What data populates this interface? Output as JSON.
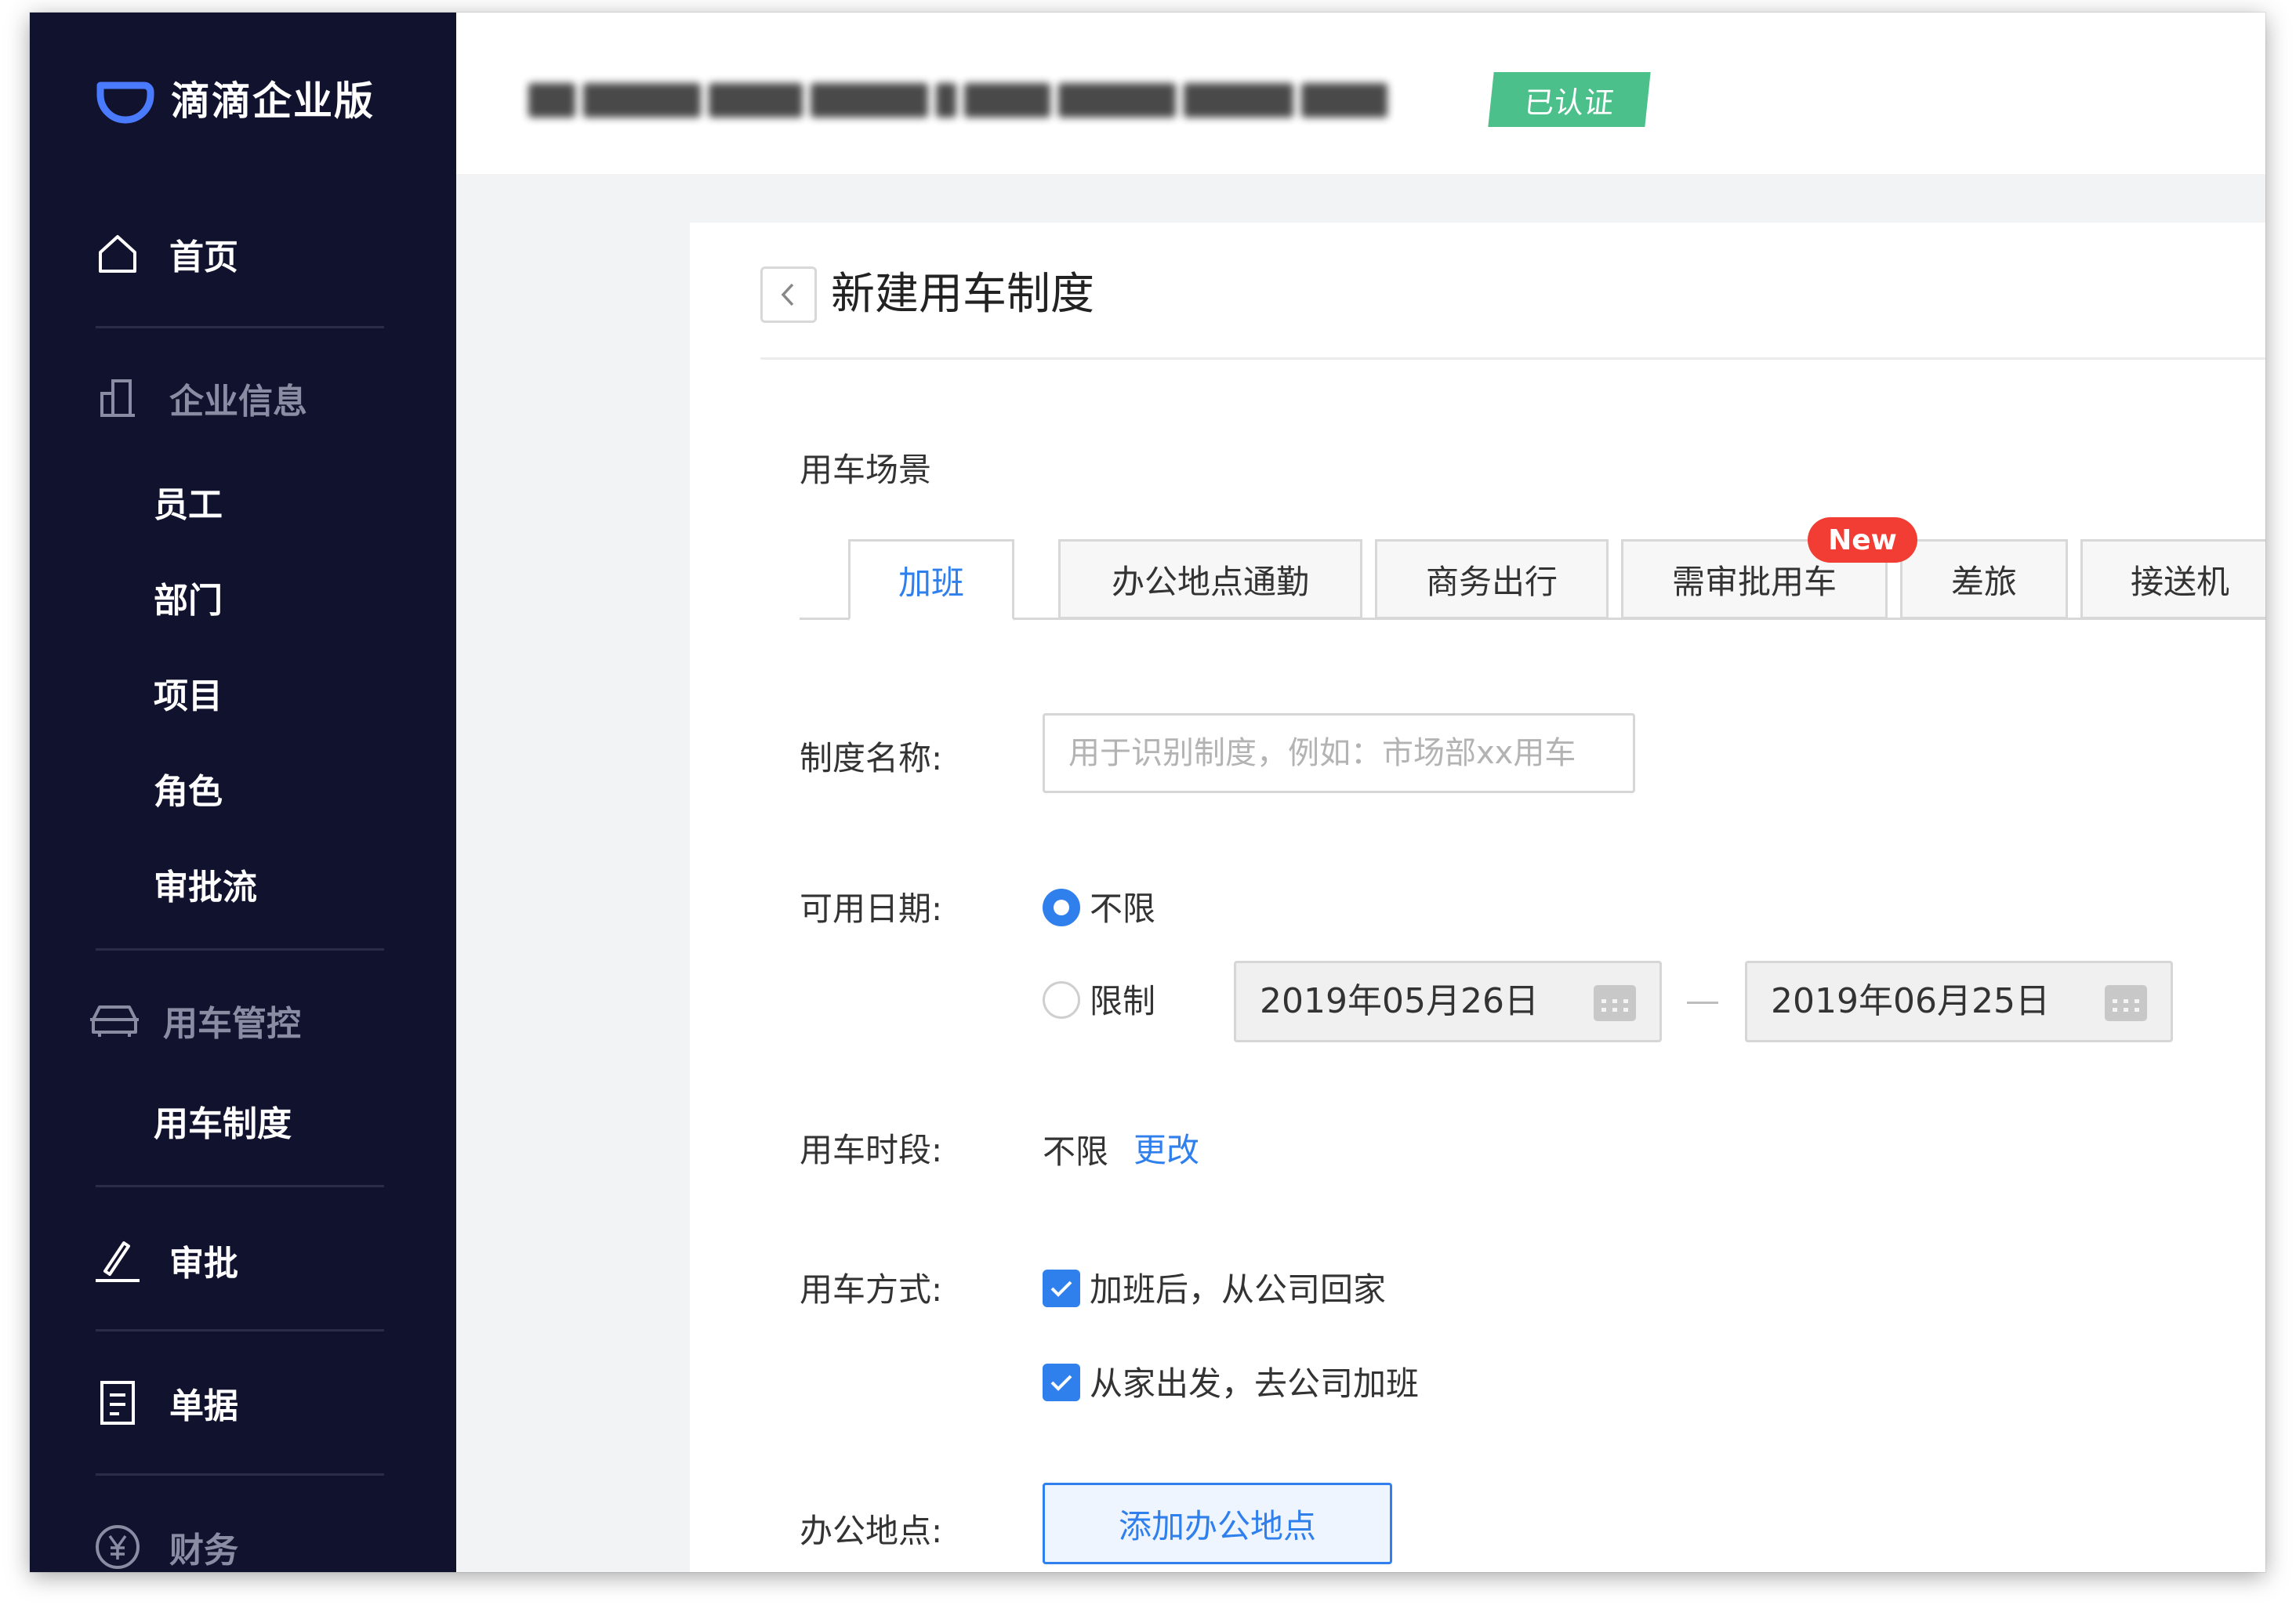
{
  "brand": {
    "name": "滴滴企业版"
  },
  "nav": {
    "home": "首页",
    "company_info": "企业信息",
    "employees": "员工",
    "departments": "部门",
    "projects": "项目",
    "roles": "角色",
    "approval_flow": "审批流",
    "car_control": "用车管控",
    "car_policy": "用车制度",
    "approval": "审批",
    "bills": "单据",
    "finance": "财务"
  },
  "header": {
    "verified_badge": "已认证"
  },
  "page": {
    "title": "新建用车制度"
  },
  "scene": {
    "label": "用车场景",
    "tabs": [
      "加班",
      "办公地点通勤",
      "商务出行",
      "需审批用车",
      "差旅",
      "接送机"
    ],
    "active_tab": "加班",
    "new_badge": "New"
  },
  "form": {
    "policy_name_label": "制度名称:",
    "policy_name_placeholder": "用于识别制度，例如：市场部xx用车",
    "date_label": "可用日期:",
    "date_unlimited": "不限",
    "date_limited": "限制",
    "date_start": "2019年05月26日",
    "date_end": "2019年06月25日",
    "time_label": "用车时段:",
    "time_value": "不限",
    "time_change": "更改",
    "mode_label": "用车方式:",
    "mode_option1": "加班后，从公司回家",
    "mode_option2": "从家出发，去公司加班",
    "office_label": "办公地点:",
    "office_add": "添加办公地点"
  },
  "colors": {
    "sidebar": "#11122e",
    "accent": "#2f80ed",
    "verified": "#4cc08a",
    "new_badge": "#f23d35"
  }
}
